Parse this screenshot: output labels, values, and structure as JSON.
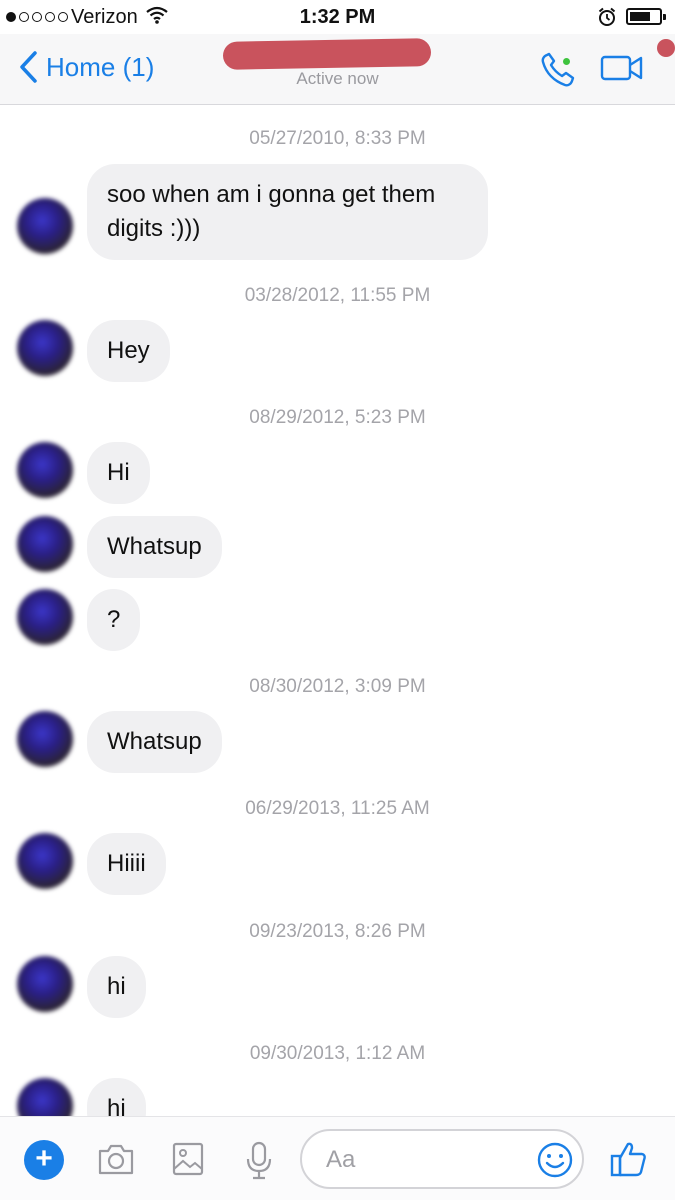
{
  "status_bar": {
    "carrier": "Verizon",
    "time": "1:32 PM",
    "signal_icon": "signal-dots-icon",
    "wifi_icon": "wifi-icon",
    "alarm_icon": "alarm-clock-icon",
    "battery_icon": "battery-icon"
  },
  "header": {
    "back_label": "Home (1)",
    "status": "Active now",
    "accent_color": "#1a7fe6",
    "online_color": "#3ec33e"
  },
  "messages": [
    {
      "timestamp": "05/27/2010, 8:33 PM",
      "lines": [
        "soo when am i gonna get them",
        "digits :)))"
      ]
    },
    {
      "timestamp": "03/28/2012, 11:55 PM",
      "lines": [
        "Hey"
      ]
    },
    {
      "timestamp": "08/29/2012, 5:23 PM",
      "lines": [
        "Hi"
      ]
    },
    {
      "lines": [
        "Whatsup"
      ]
    },
    {
      "lines": [
        "?"
      ]
    },
    {
      "timestamp": "08/30/2012, 3:09 PM",
      "lines": [
        "Whatsup"
      ]
    },
    {
      "timestamp": "06/29/2013, 11:25 AM",
      "lines": [
        "Hiiii"
      ]
    },
    {
      "timestamp": "09/23/2013, 8:26 PM",
      "lines": [
        "hi"
      ]
    },
    {
      "timestamp": "09/30/2013, 1:12 AM",
      "lines": [
        "hi"
      ]
    }
  ],
  "composer": {
    "placeholder": "Aa",
    "icons": [
      "plus-icon",
      "camera-icon",
      "image-icon",
      "microphone-icon",
      "emoji-icon",
      "thumbs-up-icon"
    ]
  }
}
